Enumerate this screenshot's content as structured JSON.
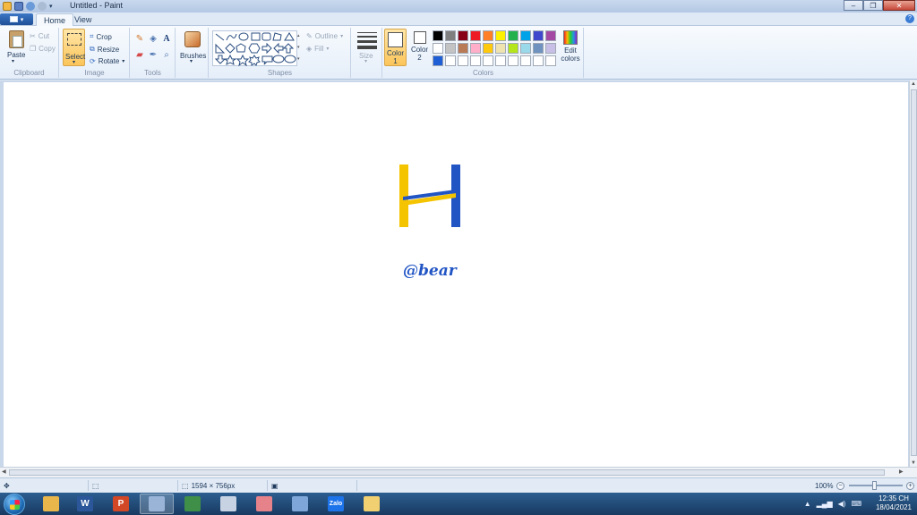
{
  "window": {
    "title": "Untitled - Paint"
  },
  "tabs": {
    "home": "Home",
    "view": "View"
  },
  "ribbon": {
    "clipboard": {
      "label": "Clipboard",
      "paste": "Paste",
      "cut": "Cut",
      "copy": "Copy"
    },
    "image": {
      "label": "Image",
      "select": "Select",
      "crop": "Crop",
      "resize": "Resize",
      "rotate": "Rotate"
    },
    "tools": {
      "label": "Tools"
    },
    "brushes": {
      "label": "Brushes"
    },
    "shapes": {
      "label": "Shapes",
      "outline": "Outline",
      "fill": "Fill"
    },
    "size": {
      "label": "Size"
    },
    "colors": {
      "label": "Colors",
      "color1_a": "Color",
      "color1_b": "1",
      "color2_a": "Color",
      "color2_b": "2",
      "edit_a": "Edit",
      "edit_b": "colors",
      "palette": [
        "#000000",
        "#7f7f7f",
        "#880015",
        "#ed1c24",
        "#ff7f27",
        "#fff200",
        "#22b14c",
        "#00a2e8",
        "#3f48cc",
        "#a349a4",
        "#ffffff",
        "#c3c3c3",
        "#b97a57",
        "#ffaec9",
        "#ffc90e",
        "#efe4b0",
        "#b5e61d",
        "#99d9ea",
        "#7092be",
        "#c8bfe7",
        "#1f5fd6",
        "#ffffff",
        "#ffffff",
        "#ffffff",
        "#ffffff",
        "#ffffff",
        "#ffffff",
        "#ffffff",
        "#ffffff",
        "#ffffff"
      ]
    }
  },
  "canvas": {
    "logo_colors": {
      "yellow": "#f5c400",
      "blue": "#2255c4"
    },
    "handle_text": "@bear"
  },
  "status": {
    "dimensions": "1594 × 756px",
    "zoom": "100%"
  },
  "taskbar": {
    "apps": [
      {
        "name": "explorer",
        "glyph": "",
        "color": "#e8b64a"
      },
      {
        "name": "word",
        "glyph": "W",
        "color": "#2b579a"
      },
      {
        "name": "powerpoint",
        "glyph": "P",
        "color": "#d24726"
      },
      {
        "name": "chrome-like",
        "glyph": "",
        "color": "#9ab4d8"
      },
      {
        "name": "excel-like",
        "glyph": "",
        "color": "#3f8f49"
      },
      {
        "name": "calculator",
        "glyph": "",
        "color": "#c7d2e3"
      },
      {
        "name": "snipping",
        "glyph": "",
        "color": "#e6828a"
      },
      {
        "name": "paint",
        "glyph": "",
        "color": "#7ea6d9"
      },
      {
        "name": "zalo",
        "glyph": "Zalo",
        "color": "#1d73ea"
      },
      {
        "name": "folder",
        "glyph": "",
        "color": "#f0d070"
      }
    ],
    "time": "12:35 CH",
    "date": "18/04/2021"
  }
}
